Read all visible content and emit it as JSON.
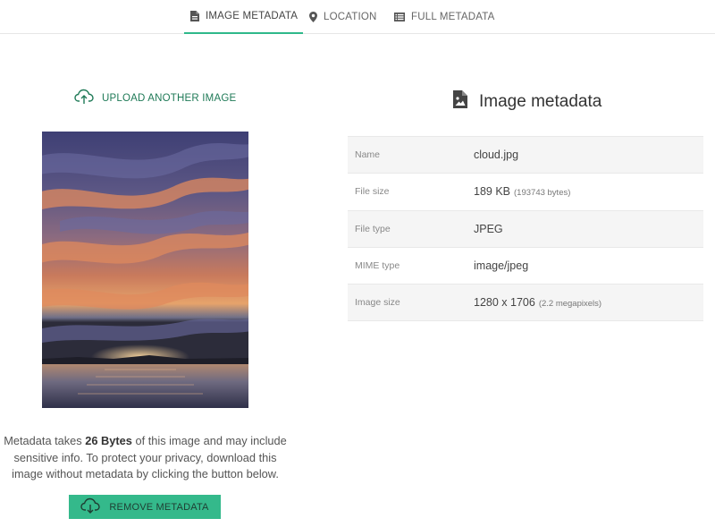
{
  "tabs": [
    {
      "label": "IMAGE METADATA",
      "icon": "document-image-icon",
      "active": true
    },
    {
      "label": "LOCATION",
      "icon": "map-pin-icon",
      "active": false
    },
    {
      "label": "FULL METADATA",
      "icon": "list-icon",
      "active": false
    }
  ],
  "upload": {
    "label": "UPLOAD ANOTHER IMAGE",
    "icon": "cloud-upload-icon"
  },
  "info": {
    "prefix": "Metadata takes ",
    "size": "26 Bytes",
    "suffix": " of this image and may include sensitive info. To protect your privacy, download this image without metadata by clicking the button below."
  },
  "remove_button": {
    "label": "REMOVE METADATA",
    "icon": "cloud-download-icon"
  },
  "panel": {
    "title": "Image metadata",
    "icon": "file-image-icon"
  },
  "metadata": [
    {
      "key": "Name",
      "value": "cloud.jpg",
      "sub": ""
    },
    {
      "key": "File size",
      "value": "189 KB",
      "sub": "(193743 bytes)"
    },
    {
      "key": "File type",
      "value": "JPEG",
      "sub": ""
    },
    {
      "key": "MIME type",
      "value": "image/jpeg",
      "sub": ""
    },
    {
      "key": "Image size",
      "value": "1280 x 1706",
      "sub": "(2.2 megapixels)"
    }
  ],
  "colors": {
    "accent": "#34b98b",
    "link": "#1f7a57",
    "tab_underline": "#2fb88a"
  }
}
